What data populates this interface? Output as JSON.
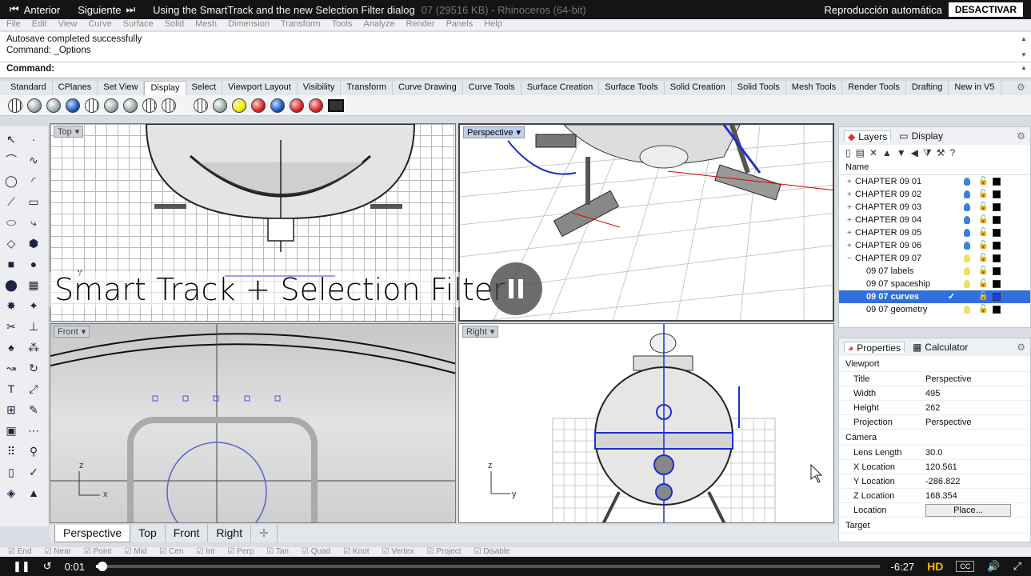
{
  "video_top": {
    "prev_label": "Anterior",
    "next_label": "Siguiente",
    "video_title": "Using the SmartTrack and the new Selection Filter dialog",
    "window_title_behind": "07  (29516 KB) - Rhinoceros (64-bit)",
    "autoplay_label": "Reproducción automática",
    "deactivate_label": "DESACTIVAR"
  },
  "menu": [
    "File",
    "Edit",
    "View",
    "Curve",
    "Surface",
    "Solid",
    "Mesh",
    "Dimension",
    "Transform",
    "Tools",
    "Analyze",
    "Render",
    "Panels",
    "Help"
  ],
  "command": {
    "history_1": "Autosave completed successfully",
    "history_2": "Command: _Options",
    "prompt": "Command:"
  },
  "toolbar_tabs": [
    "Standard",
    "CPlanes",
    "Set View",
    "Display",
    "Select",
    "Viewport Layout",
    "Visibility",
    "Transform",
    "Curve Drawing",
    "Curve Tools",
    "Surface Creation",
    "Surface Tools",
    "Solid Creation",
    "Solid Tools",
    "Mesh Tools",
    "Render Tools",
    "Drafting",
    "New in V5"
  ],
  "active_toolbar_tab": "Display",
  "viewports": {
    "top": "Top",
    "perspective": "Perspective",
    "front": "Front",
    "right": "Right"
  },
  "overlay_caption": "Smart Track + Selection Filter",
  "view_tabs": [
    "Perspective",
    "Top",
    "Front",
    "Right"
  ],
  "layers_panel": {
    "tab_layers": "Layers",
    "tab_display": "Display",
    "column_name": "Name",
    "rows": [
      {
        "name": "CHAPTER 09 01",
        "indent": 0,
        "exp": "+",
        "bulb": "#3a7fd9",
        "swatch": "#000"
      },
      {
        "name": "CHAPTER 09 02",
        "indent": 0,
        "exp": "+",
        "bulb": "#3a7fd9",
        "swatch": "#000"
      },
      {
        "name": "CHAPTER 09 03",
        "indent": 0,
        "exp": "+",
        "bulb": "#3a7fd9",
        "swatch": "#000"
      },
      {
        "name": "CHAPTER 09 04",
        "indent": 0,
        "exp": "+",
        "bulb": "#3a7fd9",
        "swatch": "#000"
      },
      {
        "name": "CHAPTER 09 05",
        "indent": 0,
        "exp": "+",
        "bulb": "#3a7fd9",
        "swatch": "#000"
      },
      {
        "name": "CHAPTER 09 06",
        "indent": 0,
        "exp": "+",
        "bulb": "#3a7fd9",
        "swatch": "#000"
      },
      {
        "name": "CHAPTER 09 07",
        "indent": 0,
        "exp": "−",
        "bulb": "#f0e060",
        "swatch": "#000"
      },
      {
        "name": "09 07 labels",
        "indent": 1,
        "exp": "",
        "bulb": "#f0e060",
        "swatch": "#000"
      },
      {
        "name": "09 07 spaceship",
        "indent": 1,
        "exp": "",
        "bulb": "#f0e060",
        "swatch": "#000"
      },
      {
        "name": "09 07 curves",
        "indent": 1,
        "exp": "",
        "bulb": "",
        "swatch": "#1a3cff",
        "selected": true,
        "check": "✓"
      },
      {
        "name": "09 07 geometry",
        "indent": 1,
        "exp": "",
        "bulb": "#f0e060",
        "swatch": "#000"
      }
    ]
  },
  "properties_panel": {
    "tab_properties": "Properties",
    "tab_calculator": "Calculator",
    "section_viewport": "Viewport",
    "section_camera": "Camera",
    "section_target": "Target",
    "viewport_rows": [
      {
        "key": "Title",
        "value": "Perspective"
      },
      {
        "key": "Width",
        "value": "495"
      },
      {
        "key": "Height",
        "value": "262"
      },
      {
        "key": "Projection",
        "value": "Perspective"
      }
    ],
    "camera_rows": [
      {
        "key": "Lens Length",
        "value": "30.0"
      },
      {
        "key": "X Location",
        "value": "120.561"
      },
      {
        "key": "Y Location",
        "value": "-286.822"
      },
      {
        "key": "Z Location",
        "value": "168.354"
      }
    ],
    "location_key": "Location",
    "place_button": "Place..."
  },
  "osnap": [
    "End",
    "Near",
    "Point",
    "Mid",
    "Cen",
    "Int",
    "Perp",
    "Tan",
    "Quad",
    "Knot",
    "Vertex",
    "Project",
    "Disable"
  ],
  "video_controls": {
    "current_time": "0:01",
    "remaining_time": "-6:27",
    "progress_fraction": 0.004,
    "hd_label": "HD",
    "cc_label": "CC"
  },
  "colors": {
    "selection_blue": "#2f6fe0",
    "curve_blue": "#1a2fd0",
    "player_dark": "#141414"
  }
}
